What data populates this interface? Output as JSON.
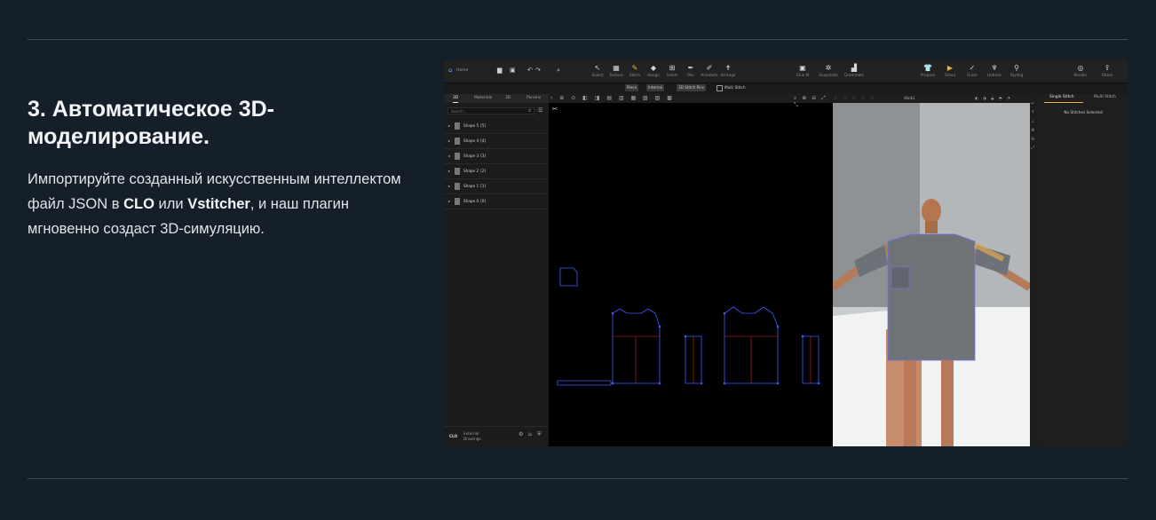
{
  "heading": "3. Автоматическое 3D-моделирование.",
  "para": {
    "p1": "Импортируйте созданный искусственным интеллектом файл JSON в ",
    "b1": "CLO",
    "p2": " или ",
    "b2": "Vstitcher",
    "p3": ", и наш плагин мгновенно создаст 3D-симуляцию."
  },
  "app": {
    "home_label": "Home",
    "tools": [
      {
        "label": "Select",
        "glyph": "↖"
      },
      {
        "label": "Texture",
        "glyph": "▦"
      },
      {
        "label": "Stitch",
        "glyph": "✎"
      },
      {
        "label": "Assign",
        "glyph": "◆"
      },
      {
        "label": "Insert",
        "glyph": "⊞"
      },
      {
        "label": "Pen",
        "glyph": "✒"
      },
      {
        "label": "Annotate",
        "glyph": "✐"
      },
      {
        "label": "Arrange",
        "glyph": "✝"
      }
    ],
    "tools_mid": [
      {
        "label": "Gine M",
        "glyph": "▣"
      },
      {
        "label": "Snapshots",
        "glyph": "✲"
      },
      {
        "label": "Grommets",
        "glyph": "▟"
      }
    ],
    "tools_right": [
      {
        "label": "Prepare",
        "glyph": "👕"
      },
      {
        "label": "Simul",
        "glyph": "▶"
      },
      {
        "label": "Finish",
        "glyph": "✓"
      },
      {
        "label": "Uvtress",
        "glyph": "♆"
      },
      {
        "label": "Styling",
        "glyph": "⚲"
      }
    ],
    "tools_far": [
      {
        "label": "Render",
        "glyph": "◎"
      },
      {
        "label": "Share",
        "glyph": "⇪"
      }
    ],
    "subbar": {
      "piece": "Piece",
      "internal": "Internal",
      "stitch_pins": "3D Stitch Pins",
      "multi_stitch": "Multi Stitch"
    },
    "panel_tabs": [
      "3D",
      "Materials",
      "3D",
      "Params"
    ],
    "search_placeholder": "Search...",
    "shapes": [
      {
        "name": "Shape 5",
        "count": "[5]"
      },
      {
        "name": "Shape 4",
        "count": "[4]"
      },
      {
        "name": "Shape 3",
        "count": "[3]"
      },
      {
        "name": "Shape 2",
        "count": "[2]"
      },
      {
        "name": "Shape 1",
        "count": "[1]"
      },
      {
        "name": "Shape 0",
        "count": "[0]"
      }
    ],
    "footer_brand": "CLO",
    "footer_line1": "External",
    "footer_line2": "Drawings",
    "view3d_select": "Walk1",
    "right_tabs": [
      "Single Stitch",
      "Multi Stitch"
    ],
    "right_message": "No Stitches Selected",
    "colors": {
      "accent": "#f2b233",
      "pattern_blue": "#3d5bff",
      "pattern_red": "#d02b2b"
    }
  }
}
